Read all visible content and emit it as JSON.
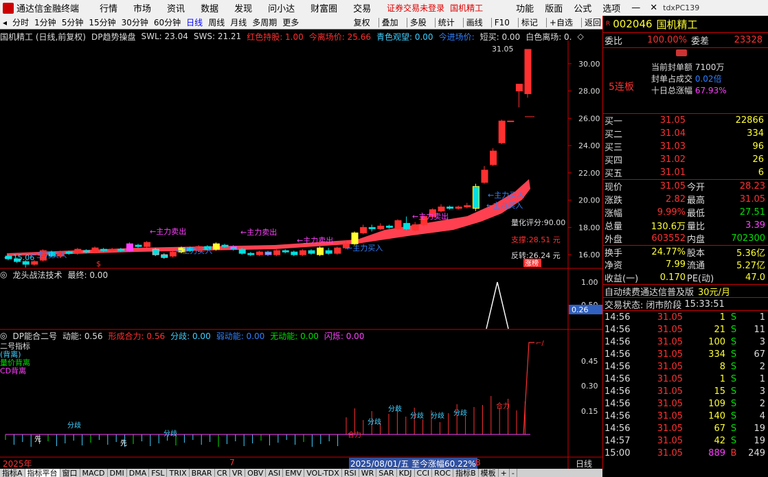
{
  "titlebar": {
    "app": "通达信金融终端",
    "menus": [
      "行情",
      "市场",
      "资讯",
      "数据",
      "发现",
      "问小达",
      "财富圈",
      "交易"
    ],
    "warning": "证券交易未登录",
    "stock": "国机精工",
    "menus2": [
      "功能",
      "版面",
      "公式",
      "选项"
    ],
    "account": "tdxPC139"
  },
  "toolbar": {
    "periods": [
      "分时",
      "1分钟",
      "5分钟",
      "15分钟",
      "30分钟",
      "60分钟",
      "日线",
      "周线",
      "月线",
      "多周期",
      "更多"
    ],
    "active": "日线",
    "tools": [
      "复权",
      "叠加",
      "多股",
      "统计",
      "画线",
      "F10",
      "标记",
      "+自选",
      "返回"
    ]
  },
  "main_header": {
    "name": "国机精工 (日线,前复权)",
    "indicator": "DP趋势操盘",
    "swl": "SWL: 23.04",
    "sws": "SWS: 21.21",
    "hold": "红色持股: 1.00",
    "leave": "今离场价: 25.66",
    "watch": "青色观望: 0.00",
    "enter": "今进场价:",
    "short": "短买: 0.00",
    "white": "白色离场: 0.",
    "marker": "◇"
  },
  "sub1_header": {
    "name": "龙头战法技术",
    "val": "最终: 0.00"
  },
  "sub2_header": {
    "name": "DP能合二号",
    "dn": "动能: 0.56",
    "xc": "形成合力: 0.56",
    "fq": "分歧: 0.00",
    "rdn": "弱动能: 0.00",
    "wdn": "无动能: 0.00",
    "sx": "闪烁: 0.00"
  },
  "sub2_legend": [
    "二号指标",
    "(背离)",
    "量价背离",
    "CD背离"
  ],
  "annot": {
    "high": "31.05",
    "low": "15.06",
    "score": "量化评分:90.00",
    "support": "支撑:28.51 元",
    "reverse": "反转:26.24 元",
    "zt": "涨榜",
    "buy": "主力买入",
    "sell": "主力卖出",
    "sub2_peak": "1.00",
    "sub2_val": "0.26",
    "fq": "分歧",
    "xc": "合力",
    "x": "先"
  },
  "yaxis_main": [
    "30.00",
    "28.00",
    "26.00",
    "24.00",
    "22.00",
    "20.00",
    "18.00",
    "16.00"
  ],
  "yaxis_sub1": [
    "1.00",
    "0.50"
  ],
  "yaxis_sub2": [
    "0.45",
    "0.30",
    "0.15"
  ],
  "xaxis": {
    "y2025": "2025年",
    "m7": "7",
    "date": "2025/08/01/五 至今涨幅60.22%",
    "m8": "8",
    "period": "日线"
  },
  "bottom_tabs": [
    "指标A",
    "指标平台",
    "窗口",
    "MACD",
    "DMI",
    "DMA",
    "FSL",
    "TRIX",
    "BRAR",
    "CR",
    "VR",
    "OBV",
    "ASI",
    "EMV",
    "VOL-TDX",
    "RSI",
    "WR",
    "SAR",
    "KDJ",
    "CCI",
    "ROC",
    "指标B",
    "模板",
    "+",
    "-"
  ],
  "quote": {
    "code": "002046",
    "name": "国机精工",
    "wb_label": "委比",
    "wb": "100.00%",
    "wc_label": "委差",
    "wc": "23328",
    "lb": "5连板",
    "fd_label": "当前封单额",
    "fd": "7100万",
    "fdcj_label": "封单占成交",
    "fdcj": "0.02倍",
    "zf_label": "十日总涨幅",
    "zf": "67.93%",
    "buy": [
      {
        "l": "买一",
        "p": "31.05",
        "v": "22866"
      },
      {
        "l": "买二",
        "p": "31.04",
        "v": "334"
      },
      {
        "l": "买三",
        "p": "31.03",
        "v": "96"
      },
      {
        "l": "买四",
        "p": "31.02",
        "v": "26"
      },
      {
        "l": "买五",
        "p": "31.01",
        "v": "6"
      }
    ],
    "stats": [
      [
        "现价",
        "31.05",
        "今开",
        "28.23"
      ],
      [
        "涨跌",
        "2.82",
        "最高",
        "31.05"
      ],
      [
        "涨幅",
        "9.99%",
        "最低",
        "27.51"
      ],
      [
        "总量",
        "130.6万",
        "量比",
        "3.39"
      ],
      [
        "外盘",
        "603552",
        "内盘",
        "702300"
      ],
      [
        "换手",
        "24.77%",
        "股本",
        "5.36亿"
      ],
      [
        "净资",
        "7.99",
        "流通",
        "5.27亿"
      ],
      [
        "收益(一)",
        "0.170",
        "PE(动)",
        "47.0"
      ]
    ],
    "ad": "自动续费通达信普及版",
    "ad_price": "30元/月",
    "status_label": "交易状态:",
    "status": "闭市阶段",
    "status_time": "15:33:51",
    "ticks": [
      [
        "14:56",
        "31.05",
        "1",
        "S",
        "1"
      ],
      [
        "14:56",
        "31.05",
        "21",
        "S",
        "11"
      ],
      [
        "14:56",
        "31.05",
        "100",
        "S",
        "3"
      ],
      [
        "14:56",
        "31.05",
        "334",
        "S",
        "67"
      ],
      [
        "14:56",
        "31.05",
        "8",
        "S",
        "2"
      ],
      [
        "14:56",
        "31.05",
        "1",
        "S",
        "1"
      ],
      [
        "14:56",
        "31.05",
        "15",
        "S",
        "3"
      ],
      [
        "14:56",
        "31.05",
        "109",
        "S",
        "2"
      ],
      [
        "14:56",
        "31.05",
        "140",
        "S",
        "4"
      ],
      [
        "14:56",
        "31.05",
        "67",
        "S",
        "19"
      ],
      [
        "14:57",
        "31.05",
        "42",
        "S",
        "19"
      ],
      [
        "15:00",
        "31.05",
        "889",
        "B",
        "249"
      ]
    ]
  },
  "chart_data": {
    "type": "candlestick",
    "ylim": [
      15,
      31.5
    ],
    "candles": [
      [
        15.9,
        15.7,
        16.0,
        15.6
      ],
      [
        15.7,
        15.5,
        15.8,
        15.4
      ],
      [
        15.5,
        15.3,
        15.6,
        15.06
      ],
      [
        15.3,
        15.5,
        15.6,
        15.2
      ],
      [
        15.6,
        16.3,
        16.4,
        15.5
      ],
      [
        16.2,
        15.9,
        16.3,
        15.8
      ],
      [
        15.9,
        16.2,
        16.3,
        15.8
      ],
      [
        16.2,
        16.1,
        16.3,
        16.0
      ],
      [
        16.1,
        16.4,
        16.5,
        16.0
      ],
      [
        16.3,
        16.2,
        16.4,
        16.1
      ],
      [
        16.2,
        16.5,
        16.6,
        16.1
      ],
      [
        16.4,
        16.3,
        16.5,
        16.2
      ],
      [
        16.3,
        16.4,
        16.5,
        16.2
      ],
      [
        16.4,
        16.3,
        16.5,
        16.2
      ],
      [
        16.3,
        16.8,
        16.9,
        16.2
      ],
      [
        16.7,
        16.6,
        16.8,
        16.5
      ],
      [
        16.6,
        16.9,
        17.0,
        16.5
      ],
      [
        16.4,
        16.0,
        16.5,
        15.9
      ],
      [
        16.0,
        15.8,
        16.1,
        15.7
      ],
      [
        15.9,
        16.2,
        16.3,
        15.8
      ],
      [
        16.2,
        16.5,
        16.6,
        16.1
      ],
      [
        16.5,
        16.3,
        16.6,
        16.2
      ],
      [
        16.3,
        16.6,
        16.7,
        16.2
      ],
      [
        16.6,
        16.4,
        16.7,
        16.3
      ],
      [
        16.4,
        16.8,
        16.9,
        16.3
      ],
      [
        16.7,
        16.6,
        16.8,
        16.5
      ],
      [
        16.6,
        16.4,
        16.7,
        16.3
      ],
      [
        16.4,
        16.1,
        16.5,
        16.0
      ],
      [
        16.1,
        16.0,
        16.2,
        15.9
      ],
      [
        16.0,
        16.2,
        16.3,
        15.9
      ],
      [
        16.2,
        16.0,
        16.3,
        15.9
      ],
      [
        16.0,
        16.3,
        16.4,
        15.9
      ],
      [
        16.3,
        16.2,
        16.4,
        16.1
      ],
      [
        16.2,
        16.0,
        16.3,
        15.9
      ],
      [
        16.0,
        16.3,
        16.4,
        15.9
      ],
      [
        16.3,
        16.1,
        16.4,
        16.0
      ],
      [
        16.0,
        16.5,
        16.6,
        15.9
      ],
      [
        16.3,
        16.1,
        16.5,
        16.0
      ],
      [
        16.1,
        16.5,
        16.6,
        16.0
      ],
      [
        16.5,
        16.8,
        17.0,
        16.4
      ],
      [
        16.8,
        17.6,
        17.7,
        16.7
      ],
      [
        17.6,
        18.0,
        18.2,
        17.5
      ],
      [
        18.0,
        17.9,
        18.2,
        17.7
      ],
      [
        17.9,
        18.1,
        18.3,
        17.8
      ],
      [
        18.1,
        18.0,
        18.2,
        17.9
      ],
      [
        17.9,
        18.5,
        18.6,
        17.8
      ],
      [
        18.3,
        17.9,
        18.8,
        17.8
      ],
      [
        17.8,
        18.2,
        18.4,
        17.7
      ],
      [
        18.2,
        18.8,
        18.9,
        18.1
      ],
      [
        18.8,
        19.3,
        19.4,
        18.7
      ],
      [
        19.2,
        19.5,
        19.7,
        19.1
      ],
      [
        19.5,
        19.4,
        19.6,
        19.3
      ],
      [
        19.4,
        19.5,
        19.6,
        19.3
      ],
      [
        19.5,
        19.6,
        19.8,
        19.4
      ],
      [
        21.0,
        19.4,
        21.2,
        19.2
      ],
      [
        21.3,
        22.2,
        22.5,
        21.2
      ],
      [
        22.6,
        23.6,
        23.8,
        22.5
      ],
      [
        24.2,
        25.8,
        25.9,
        24.1
      ],
      [
        25.8,
        25.8,
        25.8,
        25.8
      ],
      [
        28.0,
        28.5,
        28.5,
        26.8
      ],
      [
        27.8,
        31.05,
        31.05,
        27.51
      ]
    ]
  }
}
